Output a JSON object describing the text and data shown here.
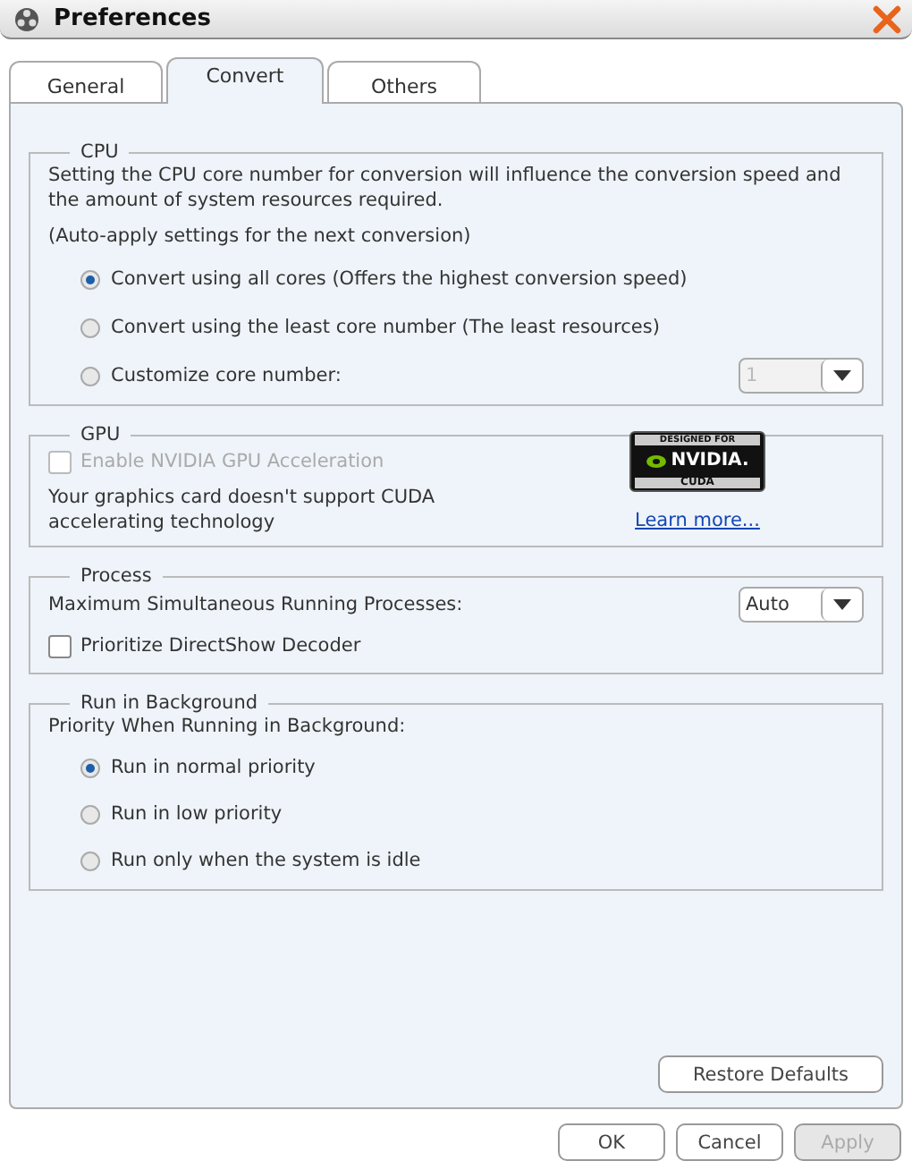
{
  "window": {
    "title": "Preferences"
  },
  "tabs": [
    {
      "label": "General",
      "selected": false
    },
    {
      "label": "Convert",
      "selected": true
    },
    {
      "label": "Others",
      "selected": false
    }
  ],
  "cpu": {
    "title": "CPU",
    "description": "Setting the CPU core number for conversion will influence the conversion speed and the amount of system resources required.",
    "note": "(Auto-apply settings for the next conversion)",
    "options": [
      {
        "label": "Convert using all cores (Offers the highest conversion speed)",
        "selected": true
      },
      {
        "label": "Convert using the least core number (The least resources)",
        "selected": false
      },
      {
        "label": "Customize core number:",
        "selected": false
      }
    ],
    "core_select": {
      "value": "1",
      "disabled": true
    }
  },
  "gpu": {
    "title": "GPU",
    "checkbox": {
      "label": "Enable NVIDIA GPU Acceleration",
      "checked": false,
      "disabled": true
    },
    "message": "Your graphics card doesn't support CUDA accelerating technology",
    "logo": {
      "top": "DESIGNED FOR",
      "brand": "NVIDIA.",
      "bottom": "CUDA"
    },
    "link": "Learn more..."
  },
  "process": {
    "title": "Process",
    "label": "Maximum Simultaneous Running Processes:",
    "select": {
      "value": "Auto",
      "disabled": false
    },
    "checkbox": {
      "label": "Prioritize DirectShow Decoder",
      "checked": false,
      "disabled": false
    }
  },
  "background": {
    "title": "Run in Background",
    "label": "Priority When Running in Background:",
    "options": [
      {
        "label": "Run in normal priority",
        "selected": true
      },
      {
        "label": "Run in low priority",
        "selected": false
      },
      {
        "label": "Run only when the system is idle",
        "selected": false
      }
    ]
  },
  "restore_button": "Restore Defaults",
  "buttons": [
    {
      "label": "OK",
      "disabled": false
    },
    {
      "label": "Cancel",
      "disabled": false
    },
    {
      "label": "Apply",
      "disabled": true
    }
  ]
}
